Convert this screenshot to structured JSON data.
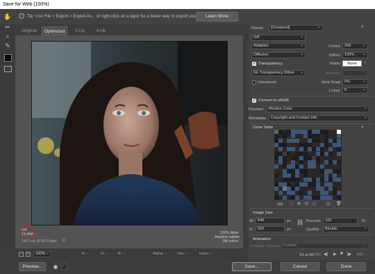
{
  "window": {
    "title": "Save for Web (100%)"
  },
  "tip": {
    "text": "Tip: Use File > Export > Export As... or right click on a layer for a faster way to export assets",
    "learn_more": "Learn More"
  },
  "tabs": [
    "Original",
    "Optimized",
    "2-Up",
    "4-Up"
  ],
  "image_info": {
    "left": [
      "GIF",
      "13.44M",
      "2462 sec @ 56.6 Kbps"
    ],
    "right": [
      "100% dither",
      "Adaptive palette",
      "256 colors"
    ]
  },
  "status": {
    "zoom": "100%",
    "r": "R: --",
    "g": "G: --",
    "b": "B: --",
    "alpha": "Alpha: --",
    "hex": "Hex: --",
    "index": "Index: --"
  },
  "buttons": {
    "preview": "Preview...",
    "save": "Save...",
    "cancel": "Cancel",
    "done": "Done"
  },
  "panel": {
    "preset_label": "Preset:",
    "preset_value": "[Unnamed]",
    "format": "GIF",
    "reduction": "Adaptive",
    "colors_label": "Colors:",
    "colors_value": "256",
    "dither_algo": "Diffusion",
    "dither_label": "Dither:",
    "dither_value": "100%",
    "transparency_label": "Transparency",
    "matte_label": "Matte:",
    "matte_value": "None",
    "trans_dither": "No Transparency Dither",
    "amount_label": "Amount:",
    "interlaced_label": "Interlaced",
    "websnap_label": "Web Snap:",
    "websnap_value": "0%",
    "lossy_label": "Lossy:",
    "lossy_value": "0",
    "convert_srgb": "Convert to sRGB",
    "preview_label": "Preview:",
    "preview_value": "Monitor Color",
    "metadata_label": "Metadata:",
    "metadata_value": "Copyright and Contact Info",
    "color_table_label": "Color Table",
    "color_count": "256",
    "image_size_label": "Image Size",
    "w_label": "W:",
    "w_value": "540",
    "h_label": "H:",
    "h_value": "500",
    "px": "px",
    "percent_label": "Percent:",
    "percent_value": "100",
    "pct": "%",
    "quality_label": "Quality:",
    "quality_value": "Bicubic",
    "animation_label": "Animation",
    "looping_label": "Looping Options:",
    "looping_value": "Forever",
    "frame_counter": "24 of 80"
  },
  "colors": {
    "accent_red": "#d8261c",
    "matte": "#ffffff"
  }
}
